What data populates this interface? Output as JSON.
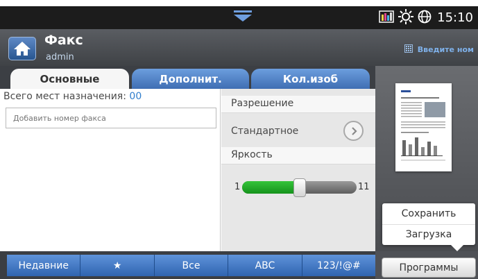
{
  "status_bar": {
    "time": "15:10",
    "icons": [
      "toner-level-icon",
      "eco-sun-icon",
      "globe-icon"
    ],
    "pull_down": "chevron-down-icon"
  },
  "header": {
    "title": "Факс",
    "user": "admin",
    "hint": "Введите ном"
  },
  "tabs": [
    {
      "label": "Основные",
      "active": true
    },
    {
      "label": "Дополнит.",
      "active": false
    },
    {
      "label": "Кол.изоб",
      "active": false
    }
  ],
  "destinations": {
    "label": "Всего мест назначения: ",
    "count": "00",
    "fax_placeholder": "Добавить номер факса"
  },
  "resolution": {
    "heading": "Разрешение",
    "value": "Стандартное"
  },
  "brightness": {
    "heading": "Яркость",
    "min": "1",
    "max": "11",
    "level": 6
  },
  "popup_menu": {
    "save": "Сохранить",
    "load": "Загрузка"
  },
  "filters": [
    "Недавние",
    "★",
    "Все",
    "ABC",
    "123/!@#"
  ],
  "programs_label": "Программы",
  "colors": {
    "accent_blue": "#3f6eb3",
    "slider_green": "#1ea925",
    "header_bg": "#4a4d52"
  }
}
